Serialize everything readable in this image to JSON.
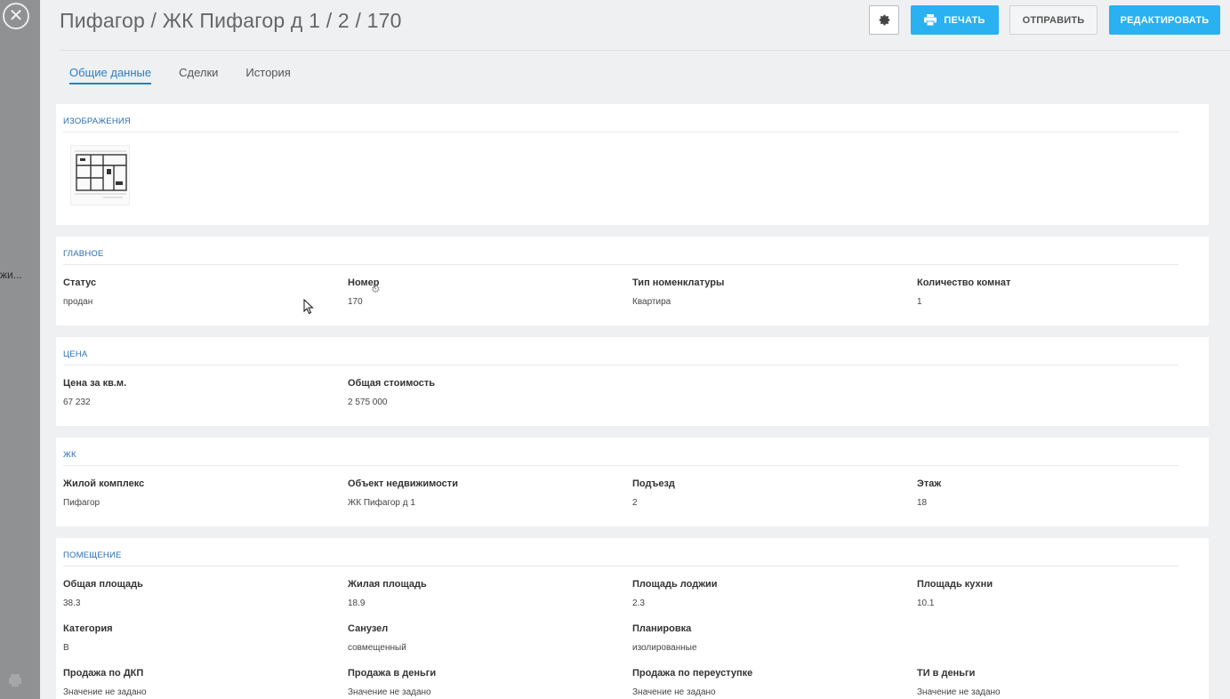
{
  "overlay": {
    "close_icon": "close-icon",
    "side_text": "жи..."
  },
  "header": {
    "title": "Пифагор / ЖК Пифагор д 1 / 2 / 170",
    "print_label": "ПЕЧАТЬ",
    "send_label": "ОТПРАВИТЬ",
    "edit_label": "РЕДАКТИРОВАТЬ",
    "accent": "#2ab1f2"
  },
  "tabs": [
    "Общие данные",
    "Сделки",
    "История"
  ],
  "sections": {
    "images": {
      "title": "ИЗОБРАЖЕНИЯ"
    },
    "main": {
      "title": "ГЛАВНОЕ",
      "fields": [
        {
          "label": "Статус",
          "value": "продан"
        },
        {
          "label": "Номер",
          "value": "170"
        },
        {
          "label": "Тип номенклатуры",
          "value": "Квартира"
        },
        {
          "label": "Количество комнат",
          "value": "1"
        }
      ]
    },
    "price": {
      "title": "ЦЕНА",
      "fields": [
        {
          "label": "Цена за кв.м.",
          "value": "67 232"
        },
        {
          "label": "Общая стоимость",
          "value": "2 575 000"
        }
      ]
    },
    "complex": {
      "title": "ЖК",
      "fields": [
        {
          "label": "Жилой комплекс",
          "value": "Пифагор"
        },
        {
          "label": "Объект недвижимости",
          "value": "ЖК Пифагор д 1"
        },
        {
          "label": "Подъезд",
          "value": "2"
        },
        {
          "label": "Этаж",
          "value": "18"
        }
      ]
    },
    "room": {
      "title": "ПОМЕЩЕНИЕ",
      "fields": [
        {
          "label": "Общая площадь",
          "value": "38.3"
        },
        {
          "label": "Жилая площадь",
          "value": "18.9"
        },
        {
          "label": "Площадь лоджии",
          "value": "2.3"
        },
        {
          "label": "Площадь кухни",
          "value": "10.1"
        },
        {
          "label": "Категория",
          "value": "В"
        },
        {
          "label": "Санузел",
          "value": "совмещенный"
        },
        {
          "label": "Планировка",
          "value": "изолированные"
        },
        {
          "label": "Продажа по ДКП",
          "value": "Значение не задано"
        },
        {
          "label": "Продажа в деньги",
          "value": "Значение не задано"
        },
        {
          "label": "Продажа по переуступке",
          "value": "Значение не задано"
        },
        {
          "label": "ТИ в деньги",
          "value": "Значение не задано"
        }
      ]
    }
  }
}
